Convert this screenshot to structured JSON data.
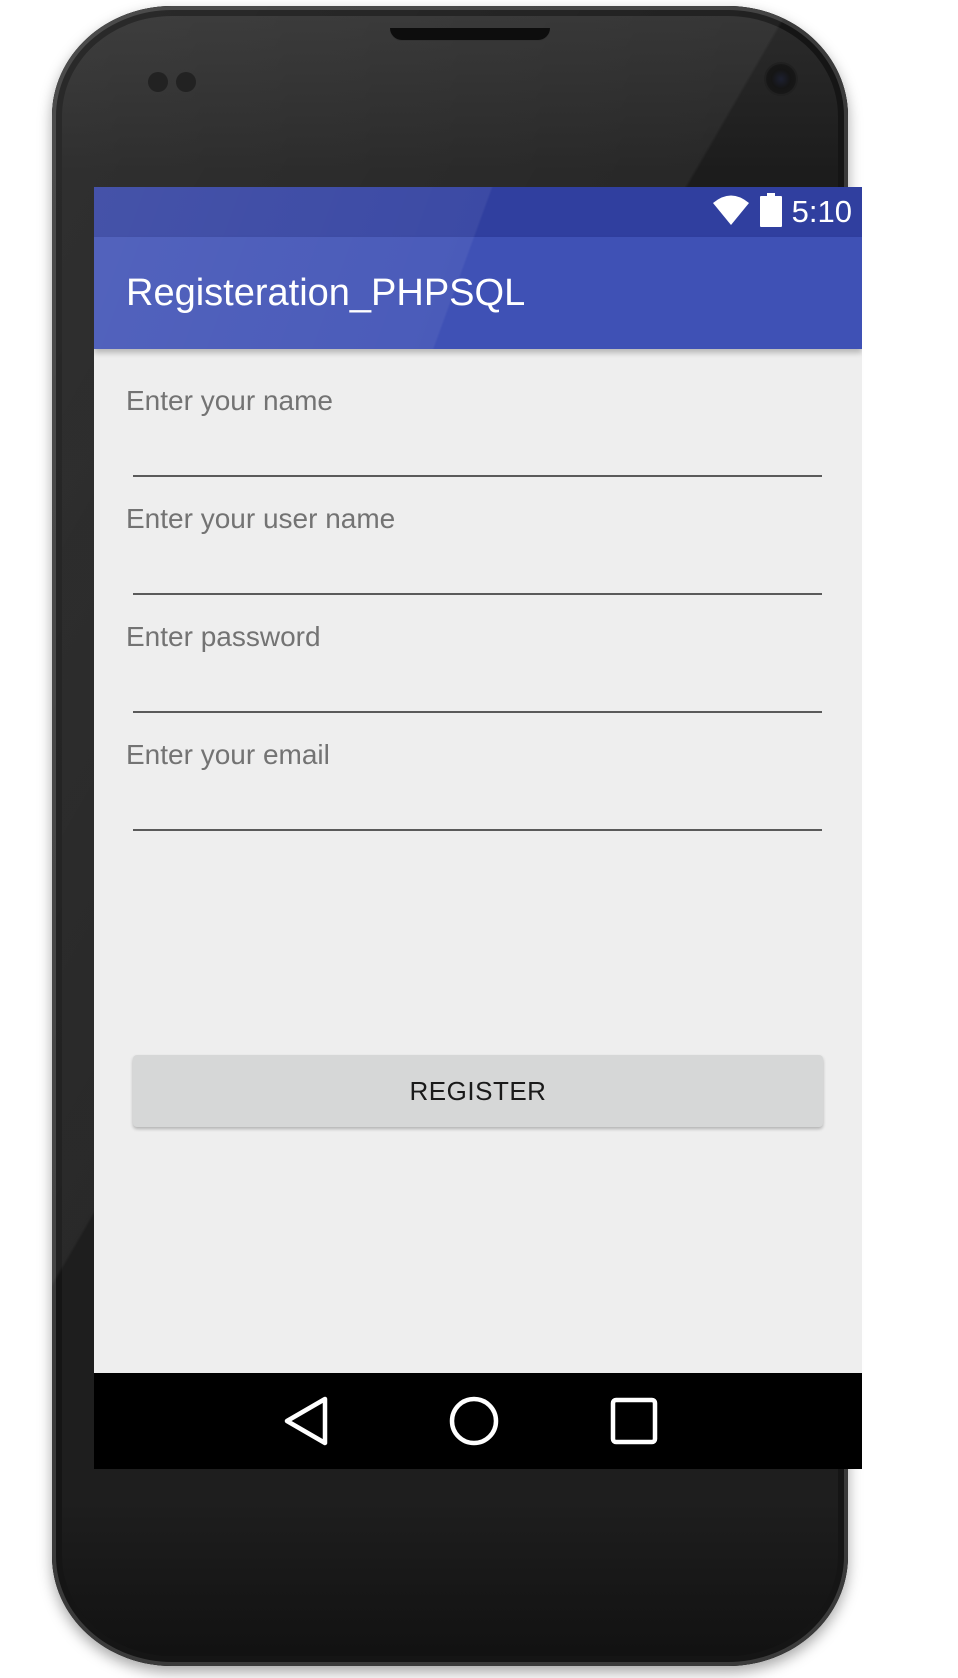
{
  "status_bar": {
    "time": "5:10",
    "icons": [
      "wifi-icon",
      "battery-icon"
    ]
  },
  "app_bar": {
    "title": "Registeration_PHPSQL"
  },
  "form": {
    "name_hint": "Enter your name",
    "username_hint": "Enter your user name",
    "password_hint": "Enter password",
    "email_hint": "Enter your email",
    "name_value": "",
    "username_value": "",
    "password_value": "",
    "email_value": ""
  },
  "register_button": {
    "label": "REGISTER"
  },
  "navigation": {
    "icons": [
      "back-icon",
      "home-icon",
      "recents-icon"
    ]
  },
  "colors": {
    "status_bar": "#303f9f",
    "app_bar": "#3f51b5",
    "background": "#eeeeee",
    "button": "#d6d7d7",
    "nav_bar": "#000000"
  }
}
